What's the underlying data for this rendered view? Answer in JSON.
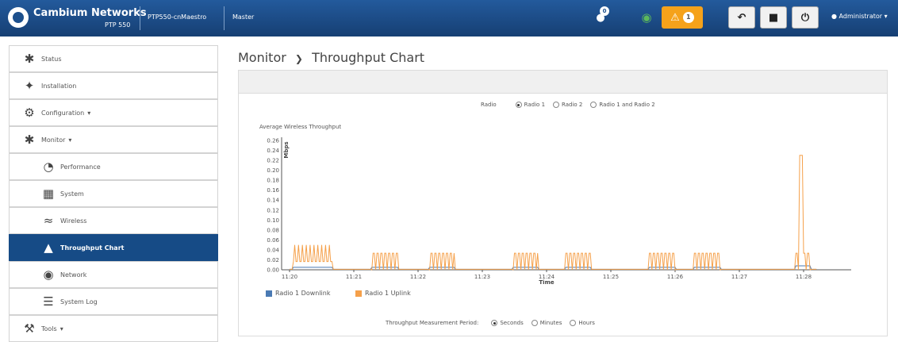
{
  "header": {
    "brand": "Cambium Networks",
    "model": "PTP 550",
    "device_name": "PTP550-cnMaestro",
    "role": "Master",
    "alarm_count": "1",
    "notification_count": "0",
    "user": "Administrator"
  },
  "sidebar": {
    "items": [
      {
        "label": "Status",
        "icon": "status-icon"
      },
      {
        "label": "Installation",
        "icon": "installation-icon"
      },
      {
        "label": "Configuration",
        "icon": "gear-icon"
      },
      {
        "label": "Monitor",
        "icon": "monitor-icon"
      },
      {
        "label": "Performance",
        "icon": "gauge-icon"
      },
      {
        "label": "System",
        "icon": "system-icon"
      },
      {
        "label": "Wireless",
        "icon": "wifi-icon"
      },
      {
        "label": "Throughput Chart",
        "icon": "area-chart-icon"
      },
      {
        "label": "Network",
        "icon": "network-icon"
      },
      {
        "label": "System Log",
        "icon": "log-icon"
      },
      {
        "label": "Tools",
        "icon": "wrench-icon"
      }
    ]
  },
  "main": {
    "breadcrumb_parent": "Monitor",
    "breadcrumb_current": "Throughput Chart",
    "radio_label": "Radio",
    "radio_options": [
      "Radio 1",
      "Radio 2",
      "Radio 1 and Radio 2"
    ],
    "radio_selected": "Radio 1",
    "chart_heading": "Average Wireless Throughput",
    "period_label": "Throughput Measurement Period:",
    "period_options": [
      "Seconds",
      "Minutes",
      "Hours"
    ],
    "period_selected": "Seconds"
  },
  "chart_data": {
    "type": "line",
    "title": "",
    "xlabel": "Time",
    "ylabel": "Mbps",
    "ylim": [
      0,
      0.26
    ],
    "yticks": [
      "0.00",
      "0.02",
      "0.04",
      "0.06",
      "0.08",
      "0.10",
      "0.12",
      "0.14",
      "0.16",
      "0.18",
      "0.20",
      "0.22",
      "0.24",
      "0.26"
    ],
    "xticks": [
      "11:20",
      "11:21",
      "11:22",
      "11:23",
      "11:24",
      "11:25",
      "11:26",
      "11:27",
      "11:28"
    ],
    "grid": false,
    "legend": "bottom-left",
    "series": [
      {
        "name": "Radio 1 Downlink",
        "color": "#4a7ab3",
        "bursts": [
          {
            "start": 0.05,
            "end": 0.68,
            "peak": 0.005
          },
          {
            "start": 1.28,
            "end": 1.7,
            "peak": 0.005
          },
          {
            "start": 2.18,
            "end": 2.58,
            "peak": 0.005
          },
          {
            "start": 3.48,
            "end": 3.88,
            "peak": 0.005
          },
          {
            "start": 4.28,
            "end": 4.68,
            "peak": 0.005
          },
          {
            "start": 5.58,
            "end": 6.0,
            "peak": 0.005
          },
          {
            "start": 6.28,
            "end": 6.7,
            "peak": 0.005
          },
          {
            "start": 7.86,
            "end": 8.1,
            "peak": 0.008
          }
        ]
      },
      {
        "name": "Radio 1 Uplink",
        "color": "#f5a04a",
        "bursts": [
          {
            "start": 0.05,
            "end": 0.68,
            "peak": 0.05
          },
          {
            "start": 1.28,
            "end": 1.7,
            "peak": 0.05
          },
          {
            "start": 2.18,
            "end": 2.58,
            "peak": 0.05
          },
          {
            "start": 3.48,
            "end": 3.88,
            "peak": 0.05
          },
          {
            "start": 4.28,
            "end": 4.68,
            "peak": 0.05
          },
          {
            "start": 5.58,
            "end": 6.0,
            "peak": 0.05
          },
          {
            "start": 6.28,
            "end": 6.7,
            "peak": 0.05
          },
          {
            "start": 7.86,
            "end": 8.1,
            "peak": 0.05
          }
        ],
        "spike": {
          "x": 7.96,
          "y": 0.23
        }
      }
    ]
  },
  "colors": {
    "header_bg": "#1c4f8c",
    "active_nav": "#164b86",
    "alarm_orange": "#f5a21b",
    "downlink": "#4a7ab3",
    "uplink": "#f5a04a"
  }
}
